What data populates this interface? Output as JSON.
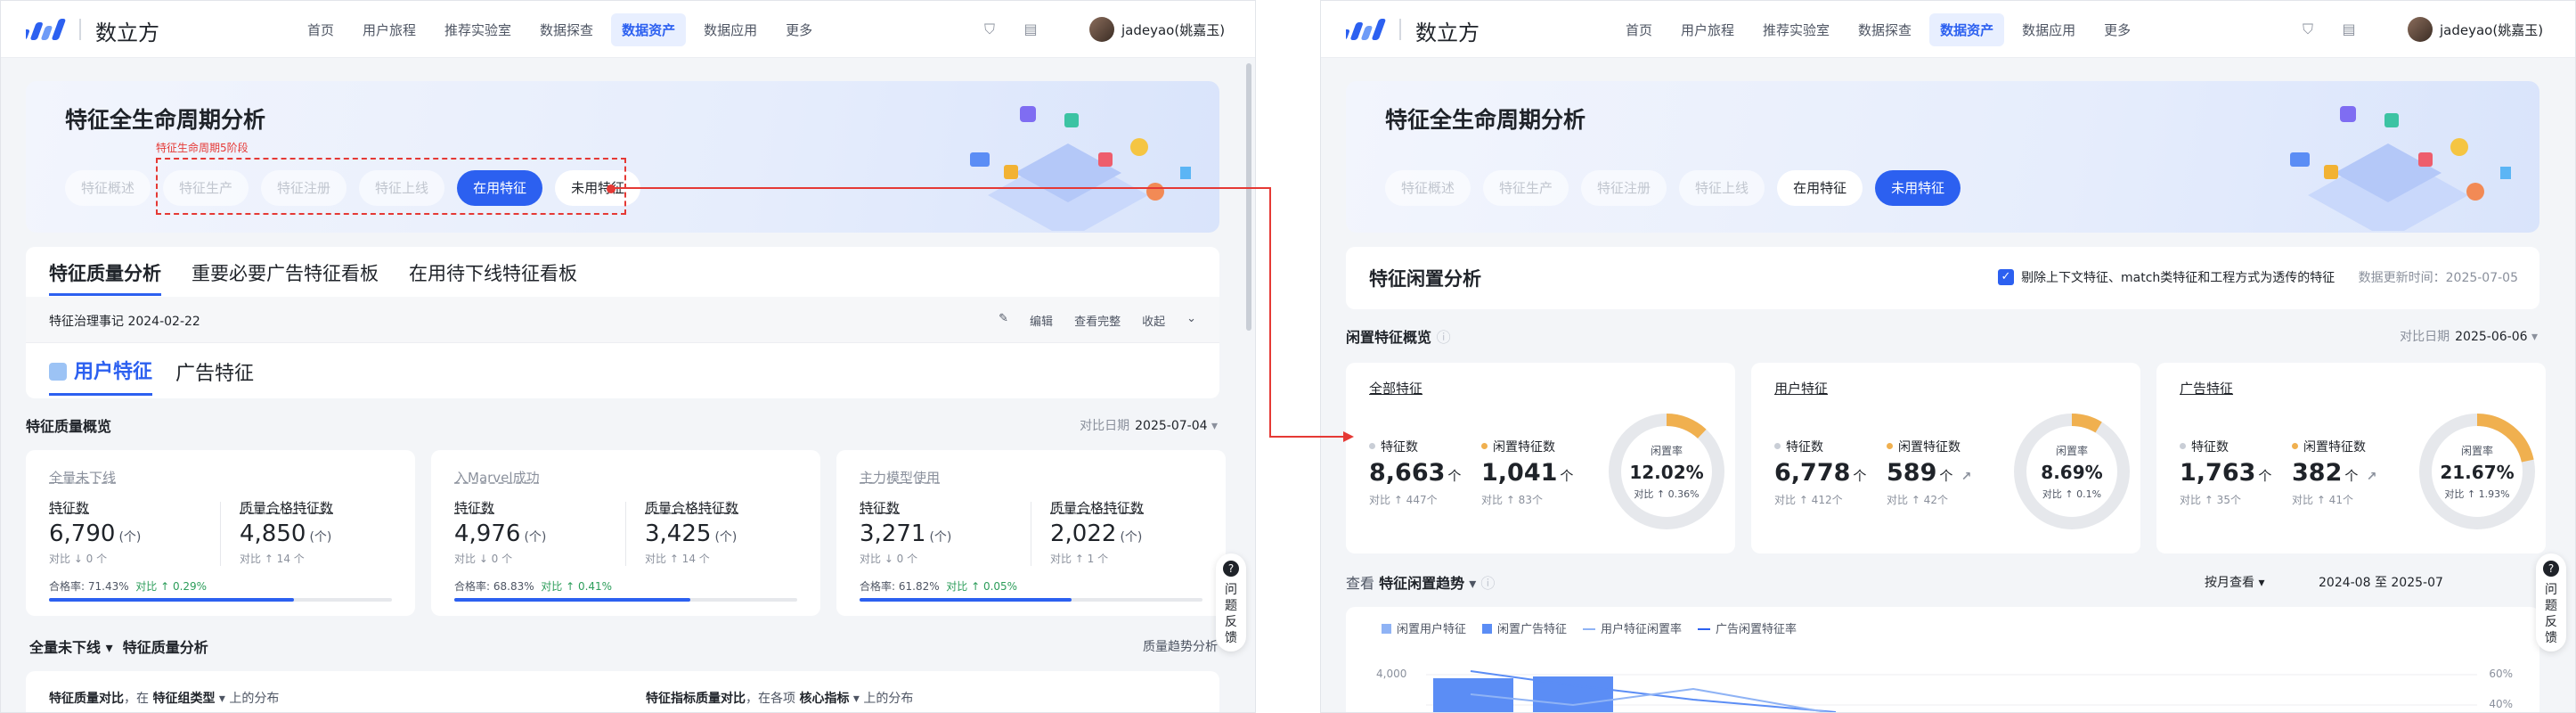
{
  "header": {
    "app_name": "数立方",
    "nav": [
      "首页",
      "用户旅程",
      "推荐实验室",
      "数据探查",
      "数据资产",
      "数据应用",
      "更多"
    ],
    "active_nav": "数据资产",
    "username": "jadeyao(姚嘉玉)"
  },
  "hero": {
    "title": "特征全生命周期分析",
    "stages": [
      "特征概述",
      "特征生产",
      "特征注册",
      "特征上线",
      "在用特征",
      "未用特征"
    ]
  },
  "annotation": {
    "label": "特征生命周期5阶段"
  },
  "left": {
    "main_tabs": [
      "特征质量分析",
      "重要必要广告特征看板",
      "在用待下线特征看板"
    ],
    "note": "特征治理事记 2024-02-22",
    "note_actions": {
      "edit": "编辑",
      "view_full": "查看完整",
      "collapse": "收起"
    },
    "feature_tabs": [
      "用户特征",
      "广告特征"
    ],
    "overview_title": "特征质量概览",
    "compare_date_label": "对比日期",
    "compare_date": "2025-07-04",
    "cards": [
      {
        "title": "全量未下线",
        "count_label": "特征数",
        "count": "6,790",
        "count_unit": "(个)",
        "count_cmp": "对比 ↓ 0 个",
        "qual_label": "质量合格特征数",
        "qual": "4,850",
        "qual_unit": "(个)",
        "qual_cmp": "对比 ↑ 14 个",
        "pass_label": "合格率:",
        "pass_rate": "71.43%",
        "pass_cmp": "对比 ↑ 0.29%",
        "pass_fraction": 0.7143
      },
      {
        "title": "入Marvel成功",
        "count_label": "特征数",
        "count": "4,976",
        "count_unit": "(个)",
        "count_cmp": "对比 ↓ 0 个",
        "qual_label": "质量合格特征数",
        "qual": "3,425",
        "qual_unit": "(个)",
        "qual_cmp": "对比 ↑ 14 个",
        "pass_label": "合格率:",
        "pass_rate": "68.83%",
        "pass_cmp": "对比 ↑ 0.41%",
        "pass_fraction": 0.6883
      },
      {
        "title": "主力模型使用",
        "count_label": "特征数",
        "count": "3,271",
        "count_unit": "(个)",
        "count_cmp": "对比 ↓ 0 个",
        "qual_label": "质量合格特征数",
        "qual": "2,022",
        "qual_unit": "(个)",
        "qual_cmp": "对比 ↑ 1 个",
        "pass_label": "合格率:",
        "pass_rate": "61.82%",
        "pass_cmp": "对比 ↑ 0.05%",
        "pass_fraction": 0.6182
      }
    ],
    "analysis_title_prefix": "全量未下线",
    "analysis_title": "特征质量分析",
    "trend_link": "质量趋势分析",
    "bottom_left": {
      "a": "特征质量对比",
      "b": "，在",
      "c": "特征组类型",
      "d": "上的分布"
    },
    "bottom_right": {
      "a": "特征指标质量对比",
      "b": "，在各项",
      "c": "核心指标",
      "d": "上的分布"
    }
  },
  "right": {
    "idle_title": "特征闲置分析",
    "checkbox_label": "剔除上下文特征、match类特征和工程方式为透传的特征",
    "update_time": "数据更新时间：2025-07-05",
    "overview_title": "闲置特征概览",
    "compare_date_label": "对比日期",
    "compare_date": "2025-06-06",
    "cards": [
      {
        "title": "全部特征",
        "count_label": "特征数",
        "count": "8,663",
        "count_unit": "个",
        "count_cmp": "对比 ↑ 447个",
        "idle_label": "闲置特征数",
        "idle": "1,041",
        "idle_unit": "个",
        "idle_cmp": "对比 ↑ 83个",
        "rate_label": "闲置率",
        "rate": "12.02%",
        "rate_cmp": "对比 ↑ 0.36%",
        "rate_fraction": 0.1202
      },
      {
        "title": "用户特征",
        "count_label": "特征数",
        "count": "6,778",
        "count_unit": "个",
        "count_cmp": "对比 ↑ 412个",
        "idle_label": "闲置特征数",
        "idle": "589",
        "idle_unit": "个",
        "idle_cmp": "对比 ↑ 42个",
        "rate_label": "闲置率",
        "rate": "8.69%",
        "rate_cmp": "对比 ↑ 0.1%",
        "rate_fraction": 0.0869
      },
      {
        "title": "广告特征",
        "count_label": "特征数",
        "count": "1,763",
        "count_unit": "个",
        "count_cmp": "对比 ↑ 35个",
        "idle_label": "闲置特征数",
        "idle": "382",
        "idle_unit": "个",
        "idle_cmp": "对比 ↑ 41个",
        "rate_label": "闲置率",
        "rate": "21.67%",
        "rate_cmp": "对比 ↑ 1.93%",
        "rate_fraction": 0.2167
      }
    ],
    "trend_prefix": "查看",
    "trend_title": "特征闲置趋势",
    "view_by": "按月查看",
    "date_range": "2024-08 至 2025-07",
    "legend": [
      "闲置用户特征",
      "闲置广告特征",
      "用户特征闲置率",
      "广告闲置特征率"
    ],
    "y_left_ticks": [
      "4,000"
    ],
    "y_right_ticks": [
      "60%",
      "40%"
    ]
  },
  "feedback": {
    "text": "问题反馈"
  },
  "colors": {
    "accent": "#2c60f0",
    "annotation": "#e53935",
    "donut": "#f0b04f",
    "up": "#2c9d5a"
  }
}
